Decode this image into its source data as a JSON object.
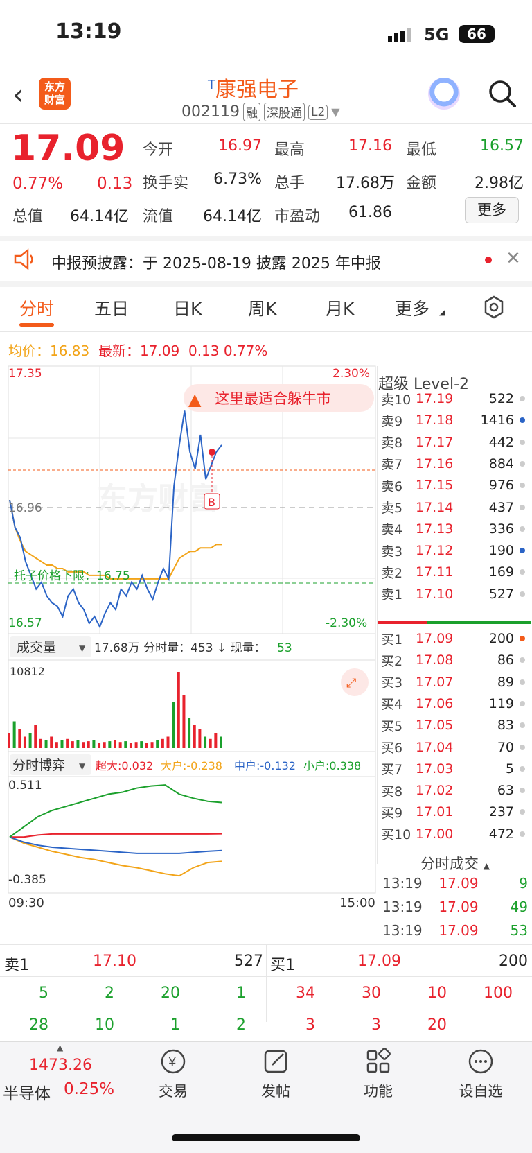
{
  "status_bar": {
    "time": "13:19",
    "network": "5G",
    "battery": "66"
  },
  "header": {
    "logo_line1": "东方",
    "logo_line2": "财富",
    "title_prefix": "T",
    "title": "康强电子",
    "code": "002119",
    "tags": [
      "融",
      "深股通",
      "L2"
    ]
  },
  "quote": {
    "price": "17.09",
    "pct": "0.77%",
    "change": "0.13",
    "fields": [
      {
        "label": "今开",
        "value": "16.97",
        "color": "red"
      },
      {
        "label": "最高",
        "value": "17.16",
        "color": "red"
      },
      {
        "label": "最低",
        "value": "16.57",
        "color": "green"
      },
      {
        "label": "换手实",
        "value": "6.73%",
        "color": "black"
      },
      {
        "label": "总手",
        "value": "17.68万",
        "color": "black"
      },
      {
        "label": "金额",
        "value": "2.98亿",
        "color": "black"
      },
      {
        "label": "总值",
        "value": "64.14亿",
        "color": "black"
      },
      {
        "label": "流值",
        "value": "64.14亿",
        "color": "black"
      },
      {
        "label": "市盈动",
        "value": "61.86",
        "color": "black"
      }
    ],
    "more": "更多"
  },
  "notice": {
    "text": "中报预披露：于 2025-08-19 披露 2025 年中报"
  },
  "tabs": [
    "分时",
    "五日",
    "日K",
    "周K",
    "月K",
    "更多"
  ],
  "info_line": {
    "avg_label": "均价：",
    "avg": "16.83",
    "last_label": "最新：",
    "last": "17.09",
    "chg": "0.13",
    "pct": "0.77%"
  },
  "chart_labels": {
    "top": "17.35",
    "top_pct": "2.30%",
    "mid": "16.96",
    "bottom": "16.57",
    "bottom_pct": "-2.30%",
    "limit": "托子价格下限：16.75",
    "promo": "这里最适合躲牛市",
    "marker": "B",
    "watermark": "东方财富",
    "vol_selector": "成交量",
    "vol_summary_a": "17.68万 分时量：453 ↓ 现量：",
    "vol_now": "53",
    "vol_max": "10812",
    "game_selector": "分时博弈",
    "game_top": "0.511",
    "game_bottom": "-0.385",
    "g_super": "超大:0.032",
    "g_big": "大户:-0.238",
    "g_mid": "中户:-0.132",
    "g_small": "小户:0.338",
    "t_start": "09:30",
    "t_end": "15:00"
  },
  "level2": {
    "title": "超级 Level-2",
    "asks": [
      {
        "label": "卖10",
        "price": "17.19",
        "vol": "522",
        "dot": "#ccc"
      },
      {
        "label": "卖9",
        "price": "17.18",
        "vol": "1416",
        "dot": "#2b64c6"
      },
      {
        "label": "卖8",
        "price": "17.17",
        "vol": "442",
        "dot": "#ccc"
      },
      {
        "label": "卖7",
        "price": "17.16",
        "vol": "884",
        "dot": "#ccc"
      },
      {
        "label": "卖6",
        "price": "17.15",
        "vol": "976",
        "dot": "#ccc"
      },
      {
        "label": "卖5",
        "price": "17.14",
        "vol": "437",
        "dot": "#ccc"
      },
      {
        "label": "卖4",
        "price": "17.13",
        "vol": "336",
        "dot": "#ccc"
      },
      {
        "label": "卖3",
        "price": "17.12",
        "vol": "190",
        "dot": "#2b64c6"
      },
      {
        "label": "卖2",
        "price": "17.11",
        "vol": "169",
        "dot": "#ccc"
      },
      {
        "label": "卖1",
        "price": "17.10",
        "vol": "527",
        "dot": "#ccc"
      }
    ],
    "bids": [
      {
        "label": "买1",
        "price": "17.09",
        "vol": "200",
        "dot": "#f35b1a"
      },
      {
        "label": "买2",
        "price": "17.08",
        "vol": "86",
        "dot": "#ccc"
      },
      {
        "label": "买3",
        "price": "17.07",
        "vol": "89",
        "dot": "#ccc"
      },
      {
        "label": "买4",
        "price": "17.06",
        "vol": "119",
        "dot": "#ccc"
      },
      {
        "label": "买5",
        "price": "17.05",
        "vol": "83",
        "dot": "#ccc"
      },
      {
        "label": "买6",
        "price": "17.04",
        "vol": "70",
        "dot": "#ccc"
      },
      {
        "label": "买7",
        "price": "17.03",
        "vol": "5",
        "dot": "#ccc"
      },
      {
        "label": "买8",
        "price": "17.02",
        "vol": "63",
        "dot": "#ccc"
      },
      {
        "label": "买9",
        "price": "17.01",
        "vol": "237",
        "dot": "#ccc"
      },
      {
        "label": "买10",
        "price": "17.00",
        "vol": "472",
        "dot": "#ccc"
      }
    ],
    "ticks_title": "分时成交",
    "ticks": [
      {
        "time": "13:19",
        "price": "17.09",
        "vol": "9"
      },
      {
        "time": "13:19",
        "price": "17.09",
        "vol": "49"
      },
      {
        "time": "13:19",
        "price": "17.09",
        "vol": "53"
      }
    ]
  },
  "queue": {
    "sell_label": "卖1",
    "sell_price": "17.10",
    "sell_total": "527",
    "buy_label": "买1",
    "buy_price": "17.09",
    "buy_total": "200",
    "sell_row1": [
      "5",
      "2",
      "20",
      "1"
    ],
    "sell_row2": [
      "28",
      "10",
      "1",
      "2"
    ],
    "buy_row1": [
      "34",
      "30",
      "10",
      "100"
    ],
    "buy_row2": [
      "3",
      "3",
      "20",
      ""
    ]
  },
  "nav": {
    "index_value": "1473.26",
    "index_name": "半导体",
    "index_pct": "0.25%",
    "items": [
      "交易",
      "发帖",
      "功能",
      "设自选"
    ]
  },
  "chart_data": {
    "type": "line",
    "title": "",
    "y_range": [
      16.57,
      17.35
    ],
    "prev_close": 16.96,
    "series": [
      {
        "color": "#2b64c6",
        "values": [
          16.96,
          16.88,
          16.85,
          16.78,
          16.74,
          16.7,
          16.72,
          16.68,
          16.66,
          16.65,
          16.62,
          16.68,
          16.7,
          16.66,
          16.64,
          16.6,
          16.62,
          16.59,
          16.63,
          16.66,
          16.64,
          16.7,
          16.68,
          16.72,
          16.7,
          16.74,
          16.7,
          16.67,
          16.72,
          16.76,
          16.73,
          17.0,
          17.12,
          17.22,
          17.1,
          17.05,
          17.15,
          17.02,
          17.06,
          17.1,
          17.12
        ]
      },
      {
        "color": "#f2a419",
        "values": [
          16.96,
          16.88,
          16.84,
          16.81,
          16.8,
          16.79,
          16.78,
          16.77,
          16.77,
          16.76,
          16.76,
          16.75,
          16.75,
          16.75,
          16.75,
          16.74,
          16.74,
          16.74,
          16.74,
          16.73,
          16.73,
          16.73,
          16.73,
          16.73,
          16.73,
          16.73,
          16.73,
          16.73,
          16.73,
          16.73,
          16.73,
          16.76,
          16.79,
          16.8,
          16.81,
          16.81,
          16.82,
          16.82,
          16.82,
          16.83,
          16.83
        ]
      }
    ],
    "volume": [
      0.2,
      0.35,
      0.25,
      0.15,
      0.2,
      0.3,
      0.12,
      0.1,
      0.15,
      0.08,
      0.1,
      0.12,
      0.09,
      0.1,
      0.08,
      0.09,
      0.1,
      0.07,
      0.08,
      0.09,
      0.1,
      0.08,
      0.09,
      0.07,
      0.08,
      0.09,
      0.07,
      0.08,
      0.1,
      0.12,
      0.15,
      0.6,
      1.0,
      0.7,
      0.4,
      0.3,
      0.25,
      0.15,
      0.12,
      0.2,
      0.15
    ],
    "game_series": [
      {
        "name": "超大",
        "color": "#e8222d",
        "values": [
          0.0,
          0.0,
          0.02,
          0.03,
          0.03,
          0.03,
          0.03,
          0.03,
          0.03,
          0.03,
          0.03,
          0.03,
          0.03,
          0.03,
          0.03,
          0.032
        ]
      },
      {
        "name": "大户",
        "color": "#f2a419",
        "values": [
          0.0,
          -0.06,
          -0.1,
          -0.14,
          -0.17,
          -0.2,
          -0.22,
          -0.25,
          -0.28,
          -0.3,
          -0.33,
          -0.36,
          -0.38,
          -0.3,
          -0.25,
          -0.238
        ]
      },
      {
        "name": "中户",
        "color": "#2b64c6",
        "values": [
          0.0,
          -0.05,
          -0.08,
          -0.1,
          -0.11,
          -0.12,
          -0.13,
          -0.14,
          -0.15,
          -0.16,
          -0.16,
          -0.16,
          -0.16,
          -0.15,
          -0.14,
          -0.132
        ]
      },
      {
        "name": "小户",
        "color": "#1ba02c",
        "values": [
          0.0,
          0.1,
          0.2,
          0.26,
          0.3,
          0.34,
          0.38,
          0.42,
          0.44,
          0.48,
          0.5,
          0.51,
          0.42,
          0.38,
          0.35,
          0.338
        ]
      }
    ]
  }
}
